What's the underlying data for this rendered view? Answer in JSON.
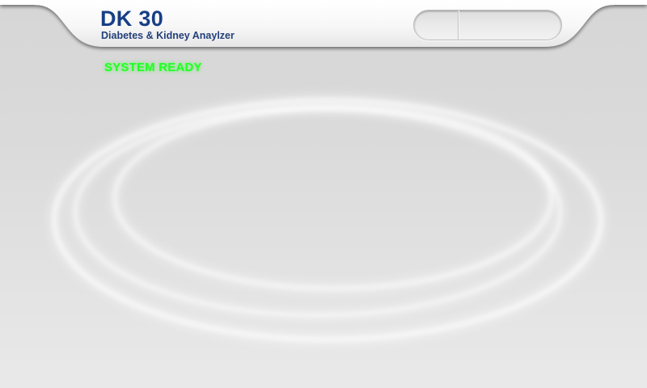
{
  "header": {
    "title": "DK 30",
    "subtitle": "Diabetes & Kidney Anaylzer"
  },
  "status": {
    "text": "SYSTEM READY",
    "color": "#22ff22"
  },
  "theme": {
    "title_color": "#173f86",
    "background": "#d9d9d9"
  }
}
